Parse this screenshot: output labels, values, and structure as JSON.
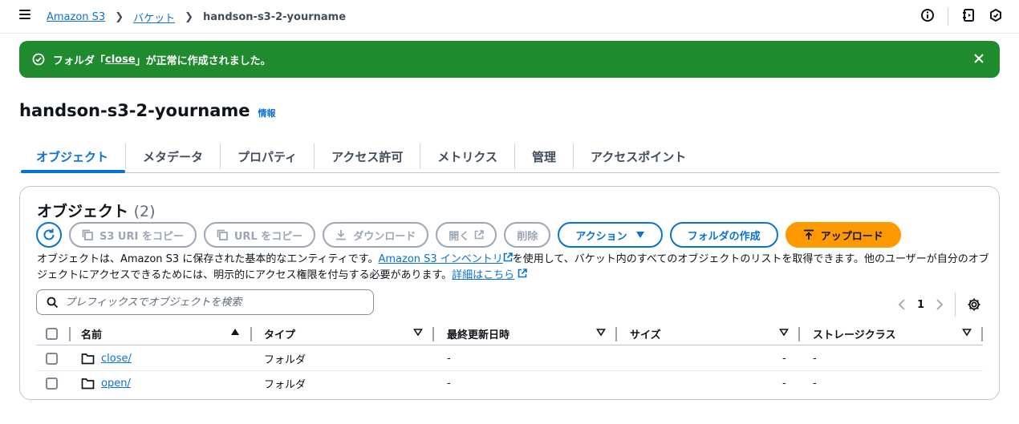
{
  "breadcrumb": {
    "root": "Amazon S3",
    "buckets": "バケット",
    "current": "handson-s3-2-yourname"
  },
  "topbar_icons": [
    "info-icon",
    "notebook-icon",
    "feedback-icon"
  ],
  "flash": {
    "prefix": "フォルダ「",
    "name": "close",
    "suffix": "」が正常に作成されました。",
    "color": "#1f8a2e"
  },
  "page": {
    "title": "handson-s3-2-yourname",
    "info": "情報"
  },
  "tabs": [
    {
      "label": "オブジェクト",
      "active": true
    },
    {
      "label": "メタデータ"
    },
    {
      "label": "プロパティ"
    },
    {
      "label": "アクセス許可"
    },
    {
      "label": "メトリクス"
    },
    {
      "label": "管理"
    },
    {
      "label": "アクセスポイント"
    }
  ],
  "objects": {
    "title": "オブジェクト",
    "count": "(2)",
    "buttons": {
      "copy_s3_uri": "S3 URI をコピー",
      "copy_url": "URL をコピー",
      "download": "ダウンロード",
      "open": "開く",
      "delete": "削除",
      "actions": "アクション",
      "create_folder": "フォルダの作成",
      "upload": "アップロード"
    },
    "description": {
      "part1": "オブジェクトは、Amazon S3 に保存された基本的なエンティティです。",
      "link1": "Amazon S3 インベントリ",
      "part2": "を使用して、バケット内のすべてのオブジェクトのリストを取得できます。他のユーザーが自分のオブジェクトにアクセスできるためには、明示的にアクセス権限を付与する必要があります。",
      "link2": "詳細はこちら"
    },
    "search_placeholder": "プレフィックスでオブジェクトを検索",
    "page_number": "1",
    "columns": {
      "name": "名前",
      "type": "タイプ",
      "last_modified": "最終更新日時",
      "size": "サイズ",
      "storage_class": "ストレージクラス"
    },
    "rows": [
      {
        "name": "close/",
        "type": "フォルダ",
        "last_modified": "-",
        "size": "-",
        "storage_class": "-"
      },
      {
        "name": "open/",
        "type": "フォルダ",
        "last_modified": "-",
        "size": "-",
        "storage_class": "-"
      }
    ]
  },
  "colors": {
    "link": "#0972d3",
    "upload": "#ff9900",
    "success": "#1f8a2e"
  }
}
